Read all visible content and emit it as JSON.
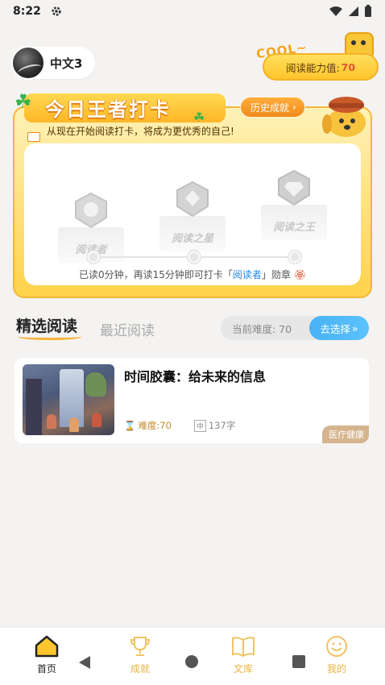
{
  "status_bar": {
    "time": "8:22",
    "icons": [
      "gear-icon",
      "wifi-icon",
      "signal-icon",
      "battery-icon"
    ]
  },
  "header": {
    "user_name": "中文3",
    "cool_text": "COOL~",
    "ability_label": "阅读能力值:",
    "ability_value": "70"
  },
  "checkin": {
    "title": "今日王者打卡",
    "subtitle": "从现在开始阅读打卡，将成为更优秀的自己!",
    "history_button": "历史成就",
    "badges": [
      {
        "label": "阅读者"
      },
      {
        "label": "阅读之星"
      },
      {
        "label": "阅读之王"
      }
    ],
    "hint_prefix": "已读0分钟，再读15分钟即可打卡「",
    "hint_highlight": "阅读者",
    "hint_suffix": "」勋章"
  },
  "tabs": {
    "active": "精选阅读",
    "inactive": "最近阅读"
  },
  "difficulty": {
    "label": "当前难度: 70",
    "button": "去选择"
  },
  "articles": [
    {
      "title": "时间胶囊：给未来的信息",
      "difficulty": "难度:70",
      "words": "137字",
      "tag": "医疗健康"
    }
  ],
  "bottom_nav": [
    {
      "label": "首页",
      "icon": "home-icon",
      "active": true
    },
    {
      "label": "成就",
      "icon": "trophy-icon",
      "active": false
    },
    {
      "label": "文库",
      "icon": "book-icon",
      "active": false
    },
    {
      "label": "我的",
      "icon": "smile-icon",
      "active": false
    }
  ],
  "colors": {
    "accent": "#ffc52d",
    "brand_orange": "#f28a1c",
    "link_blue": "#1e88e5",
    "tab_blue": "#48b2f5"
  }
}
